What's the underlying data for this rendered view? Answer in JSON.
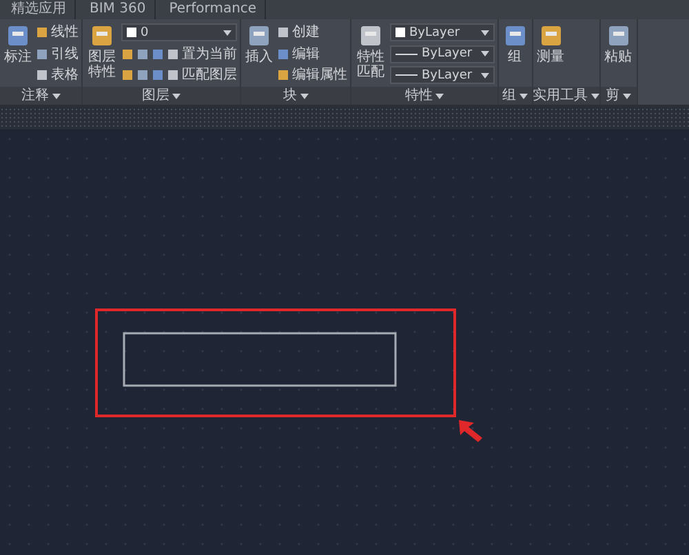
{
  "tabs": [
    {
      "label": "精选应用",
      "selected": false
    },
    {
      "label": "BIM 360",
      "selected": false
    },
    {
      "label": "Performance",
      "selected": false
    }
  ],
  "ribbon": {
    "panels": [
      {
        "label": "注释",
        "columns": [
          [
            {
              "kind": "large",
              "label": "标注"
            }
          ],
          [
            {
              "kind": "small",
              "label": "线性"
            },
            {
              "kind": "small",
              "label": "引线"
            },
            {
              "kind": "small",
              "label": "表格"
            }
          ]
        ]
      },
      {
        "label": "图层",
        "columns": [
          [
            {
              "kind": "large",
              "label": "图层特性"
            }
          ],
          [
            {
              "kind": "dropdown",
              "label": "0"
            },
            {
              "kind": "iconrow",
              "label": "置为当前"
            },
            {
              "kind": "iconrow",
              "label": "匹配图层"
            }
          ]
        ]
      },
      {
        "label": "块",
        "columns": [
          [
            {
              "kind": "large",
              "label": "插入"
            }
          ],
          [
            {
              "kind": "small",
              "label": "创建"
            },
            {
              "kind": "small",
              "label": "编辑"
            },
            {
              "kind": "small",
              "label": "编辑属性"
            }
          ]
        ]
      },
      {
        "label": "特性",
        "columns": [
          [
            {
              "kind": "large",
              "label": "特性匹配"
            }
          ],
          [
            {
              "kind": "dropdown",
              "label": "ByLayer"
            },
            {
              "kind": "linedrop",
              "label": "ByLayer"
            },
            {
              "kind": "linedrop",
              "label": "ByLayer"
            }
          ]
        ]
      },
      {
        "label": "组",
        "columns": [
          [
            {
              "kind": "large",
              "label": "组"
            }
          ]
        ]
      },
      {
        "label": "实用工具",
        "columns": [
          [
            {
              "kind": "large",
              "label": "测量"
            }
          ]
        ]
      },
      {
        "label": "剪",
        "columns": [
          [
            {
              "kind": "large",
              "label": "粘贴"
            }
          ]
        ]
      }
    ]
  }
}
